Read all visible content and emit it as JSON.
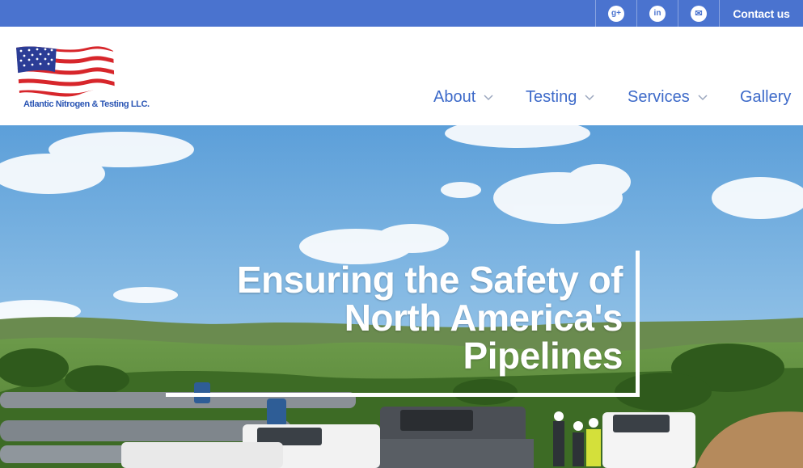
{
  "topbar": {
    "social": [
      {
        "name": "google-plus",
        "glyph": "g+"
      },
      {
        "name": "linkedin",
        "glyph": "in"
      },
      {
        "name": "email",
        "glyph": "✉"
      }
    ],
    "contact_label": "Contact us"
  },
  "logo": {
    "company": "Atlantic Nitrogen & Testing LLC."
  },
  "nav": [
    {
      "label": "About",
      "has_dropdown": true
    },
    {
      "label": "Testing",
      "has_dropdown": true
    },
    {
      "label": "Services",
      "has_dropdown": true
    },
    {
      "label": "Gallery",
      "has_dropdown": false
    }
  ],
  "hero": {
    "headline_lines": [
      "Ensuring the Safety of",
      "North America's",
      "Pipelines"
    ]
  },
  "colors": {
    "topbar": "#4a73cf",
    "nav_text": "#3d6ac9",
    "logo_text": "#2a55b4"
  }
}
